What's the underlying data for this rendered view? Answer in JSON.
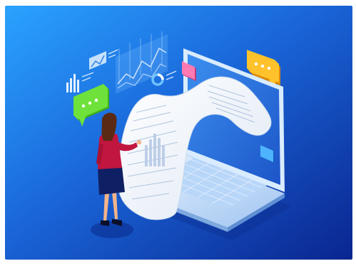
{
  "scene": {
    "subject": "isometric-illustration",
    "colors": {
      "background_top": "#1f8ff0",
      "background_bottom": "#0b2f9a",
      "laptop_frame": "#cfe6ff",
      "laptop_screen": "#2f7fe0",
      "paper": "#f2f6fb",
      "bubble_green": "#5bd12a",
      "bubble_orange": "#ffb21f",
      "bubble_pink": "#ff6fa8",
      "icon_blue": "#39a6ff",
      "shirt": "#c0163f",
      "skirt": "#0f1f63",
      "hair": "#5a2a14",
      "skin": "#f2b48a"
    }
  }
}
